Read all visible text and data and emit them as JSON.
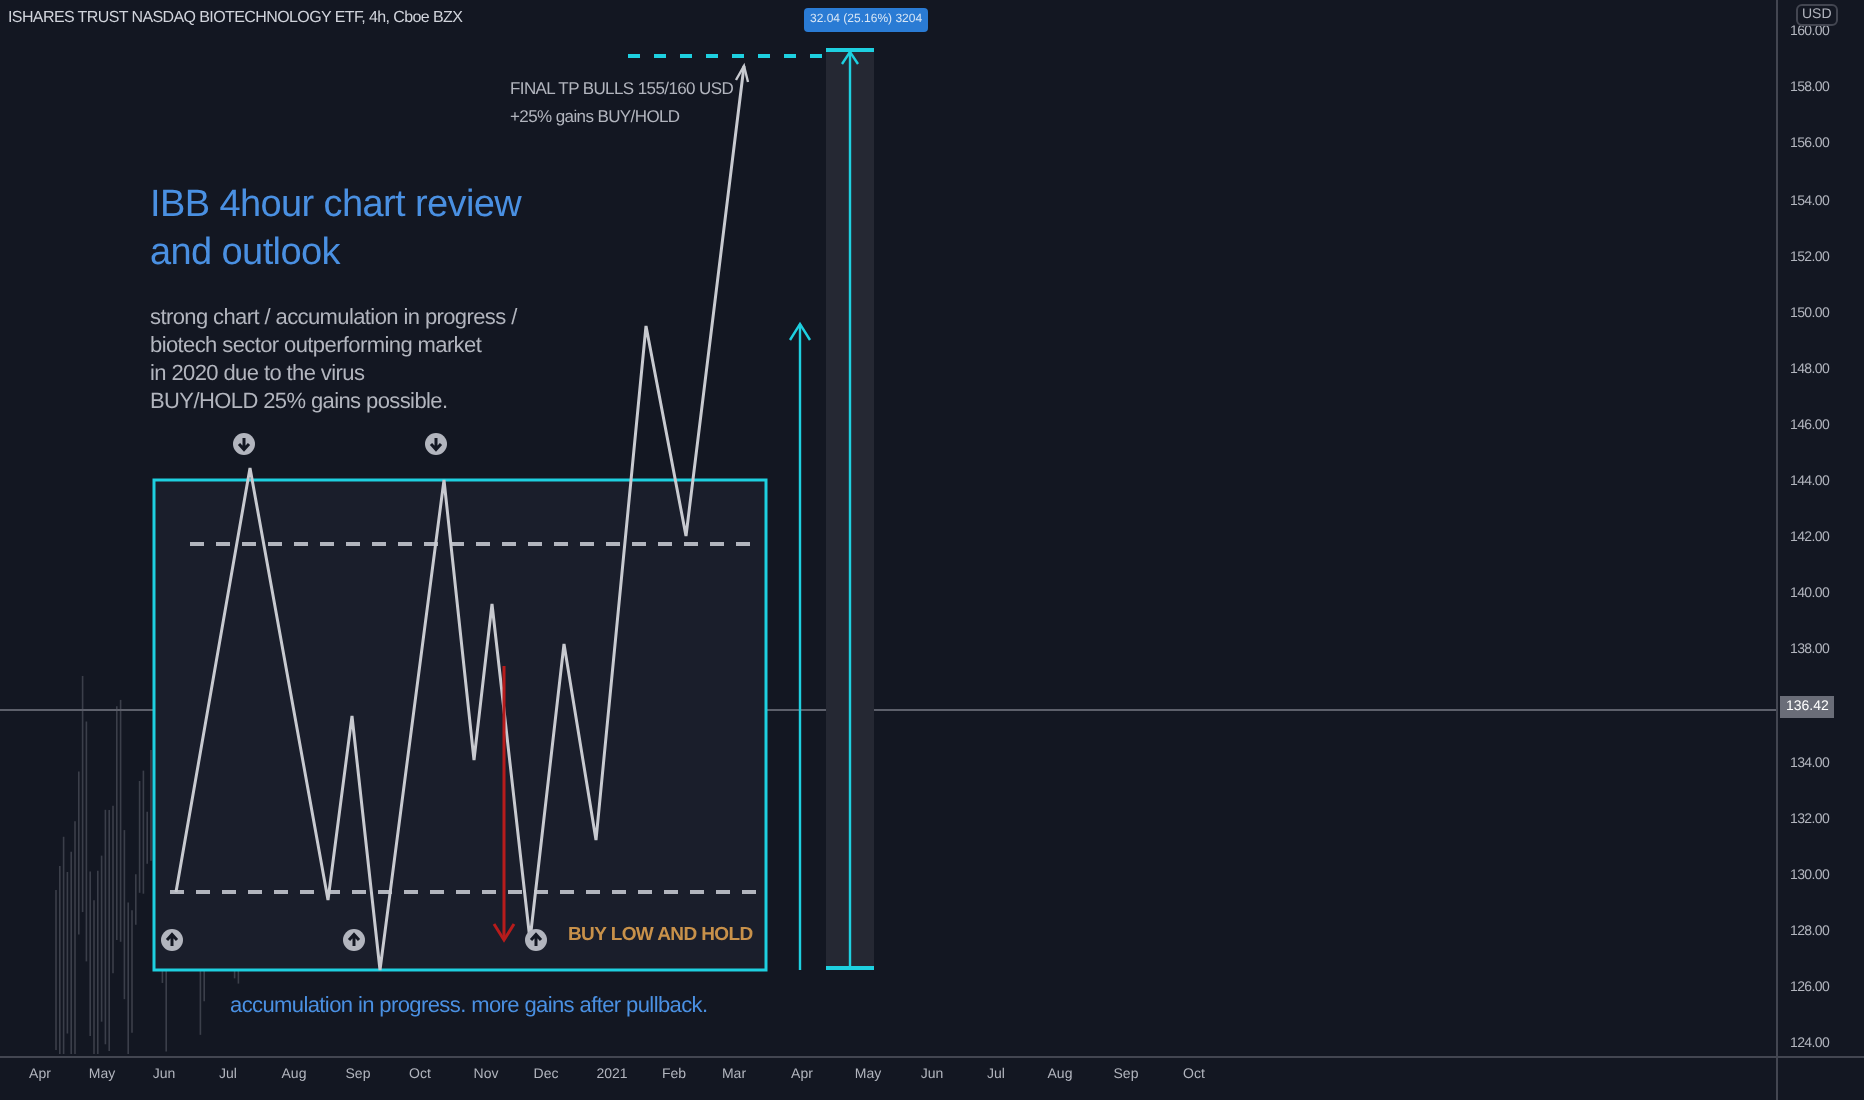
{
  "legend": {
    "title": "ISHARES TRUST NASDAQ BIOTECHNOLOGY ETF, 4h, Cboe BZX"
  },
  "chart": {
    "title_lines": [
      "IBB 4hour chart review",
      "and outlook"
    ],
    "notes": [
      "strong chart / accumulation in progress /",
      "biotech sector outperforming market",
      "in 2020 due to the virus",
      "BUY/HOLD 25% gains possible."
    ],
    "target_note": [
      "FINAL TP BULLS 155/160 USD",
      "+25% gains BUY/HOLD"
    ],
    "buy_label": "BUY LOW AND HOLD",
    "footer_note": "accumulation in progress. more gains after pullback.",
    "measure_badge": "32.04 (25.16%) 3204"
  },
  "price_axis": {
    "currency": "USD",
    "ticks": [
      "160.00",
      "158.00",
      "156.00",
      "154.00",
      "152.00",
      "150.00",
      "148.00",
      "146.00",
      "144.00",
      "142.00",
      "140.00",
      "138.00",
      "134.00",
      "132.00",
      "130.00",
      "128.00",
      "126.00",
      "124.00"
    ],
    "last_price": "136.42"
  },
  "time_axis": {
    "labels": [
      "Apr",
      "May",
      "Jun",
      "Jul",
      "Aug",
      "Sep",
      "Oct",
      "Nov",
      "Dec",
      "2021",
      "Feb",
      "Mar",
      "Apr",
      "May",
      "Jun",
      "Jul",
      "Aug",
      "Sep",
      "Oct"
    ]
  }
}
